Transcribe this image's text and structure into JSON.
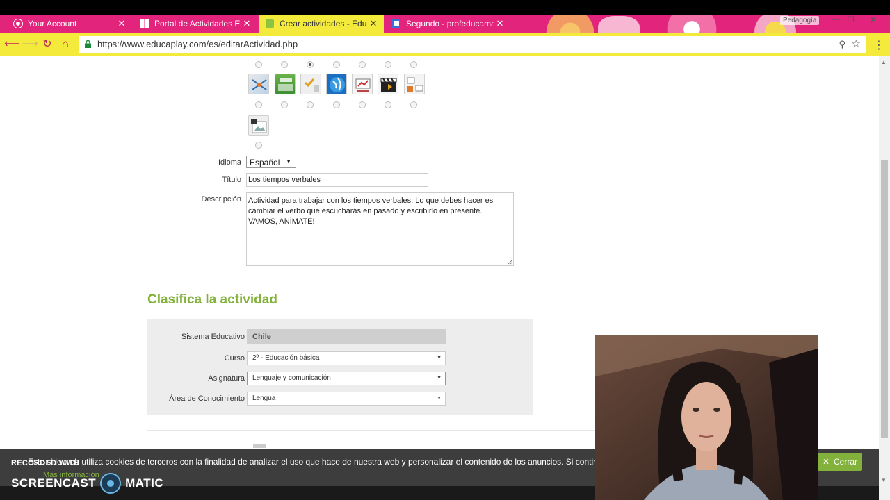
{
  "browser": {
    "tabs": [
      {
        "title": "Your Account",
        "active": false
      },
      {
        "title": "Portal de Actividades Edu",
        "active": false
      },
      {
        "title": "Crear actividades - Educ",
        "active": true
      },
      {
        "title": "Segundo - profeducama",
        "active": false
      }
    ],
    "profile_label": "Pedagogía",
    "url": "https://www.educaplay.com/es/editarActividad.php",
    "window_controls": {
      "minimize": "—",
      "maximize": "❐",
      "close": "✕"
    }
  },
  "activity_form": {
    "idioma_label": "Idioma",
    "idioma_value": "Español",
    "titulo_label": "Título",
    "titulo_value": "Los tiempos verbales",
    "descripcion_label": "Descripción",
    "descripcion_value": "Actividad para trabajar con los tiempos verbales. Lo que debes hacer es cambiar el verbo que escucharás en pasado y escribirlo en presente. VAMOS, ANÍMATE!"
  },
  "classify": {
    "title": "Clasifica la actividad",
    "fields": [
      {
        "label": "Sistema Educativo",
        "value": "Chile"
      },
      {
        "label": "Curso",
        "value": "2º - Educación básica"
      },
      {
        "label": "Asignatura",
        "value": "Lenguaje y comunicación"
      },
      {
        "label": "Área de Conocimiento",
        "value": "Lengua"
      }
    ]
  },
  "cookie_banner": {
    "text": "Este sitio web utiliza cookies de terceros con la finalidad de analizar el uso que hace de nuestra web y personalizar el contenido de los anuncios. Si continúa navegando, consideramos que acepta su uso.",
    "more_link": "Más información",
    "close_label": "Cerrar"
  },
  "watermark": {
    "line1": "RECORDED WITH",
    "line2a": "SCREENCAST",
    "line2b": "MATIC"
  },
  "colors": {
    "tab_pink": "#e2247c",
    "tab_active_yellow": "#f3ea3c",
    "accent_green": "#83b23c",
    "banner_dark": "#3d3d3d"
  },
  "icons": {
    "tab_icons": [
      "chrome-profile-icon",
      "grid-icon",
      "educaplay-icon",
      "doc-icon"
    ],
    "template_icons": [
      "crossword-icon",
      "map-quiz-icon",
      "quiz-icon",
      "globe-icon",
      "presentation-icon",
      "video-quiz-icon",
      "relate-icon",
      "image-icon"
    ]
  },
  "template_selection": {
    "row1_selected_index": 2
  }
}
